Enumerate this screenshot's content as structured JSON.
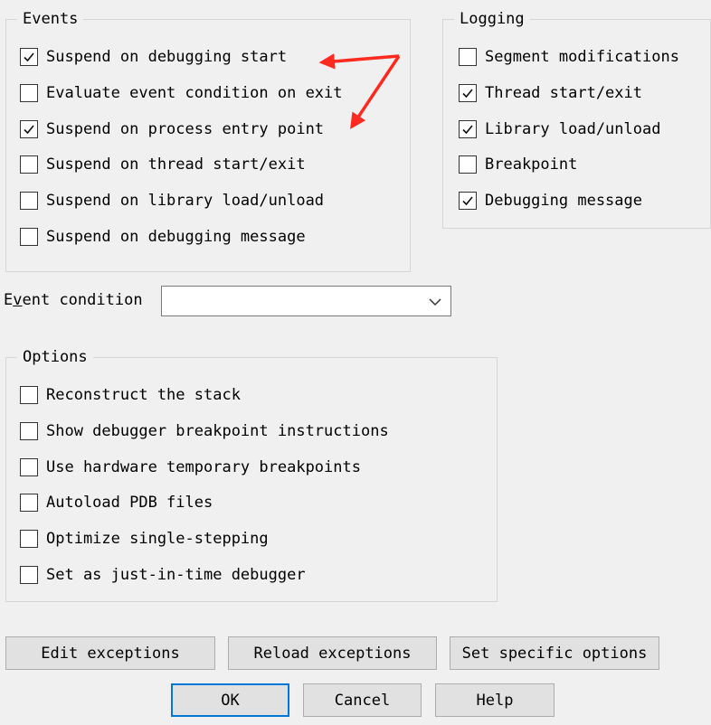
{
  "events": {
    "title": "Events",
    "items": [
      {
        "label": "Suspend on debugging start",
        "checked": true
      },
      {
        "label": "Evaluate event condition on exit",
        "checked": false
      },
      {
        "label": "Suspend on process entry point",
        "checked": true
      },
      {
        "label": "Suspend on thread start/exit",
        "checked": false
      },
      {
        "label": "Suspend on library load/unload",
        "checked": false
      },
      {
        "label": "Suspend on debugging message",
        "checked": false
      }
    ]
  },
  "logging": {
    "title": "Logging",
    "items": [
      {
        "label": "Segment modifications",
        "checked": false
      },
      {
        "label": "Thread start/exit",
        "checked": true
      },
      {
        "label": "Library load/unload",
        "checked": true
      },
      {
        "label": "Breakpoint",
        "checked": false
      },
      {
        "label": "Debugging message",
        "checked": true
      }
    ]
  },
  "event_condition": {
    "label": "Event condition",
    "value": ""
  },
  "options": {
    "title": "Options",
    "items": [
      {
        "label": "Reconstruct the stack",
        "checked": false
      },
      {
        "label": "Show debugger breakpoint instructions",
        "checked": false
      },
      {
        "label": "Use hardware temporary breakpoints",
        "checked": false
      },
      {
        "label": "Autoload PDB files",
        "checked": false
      },
      {
        "label": "Optimize single-stepping",
        "checked": false
      },
      {
        "label": "Set as just-in-time debugger",
        "checked": false
      }
    ]
  },
  "buttons": {
    "edit_exceptions": "Edit exceptions",
    "reload_exceptions": "Reload exceptions",
    "set_specific_options": "Set specific options",
    "ok": "OK",
    "cancel": "Cancel",
    "help": "Help"
  },
  "colors": {
    "annotation_arrow": "#ff2a1f",
    "default_button_border": "#0078d7"
  }
}
